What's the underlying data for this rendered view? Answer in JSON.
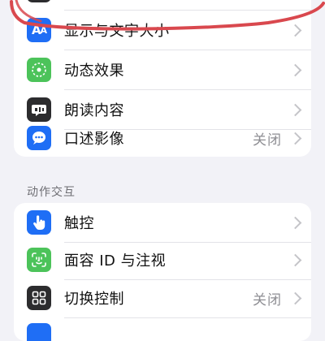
{
  "top_group": {
    "items": [
      {
        "label": "",
        "icon": "partial-hidden-icon",
        "icon_color": "#2c2c2e"
      },
      {
        "label": "显示与文字大小",
        "icon": "text-size-icon",
        "icon_color": "#1f6ef5",
        "value": ""
      },
      {
        "label": "动态效果",
        "icon": "motion-icon",
        "icon_color": "#4cc35a",
        "value": ""
      },
      {
        "label": "朗读内容",
        "icon": "speech-bubble-icon",
        "icon_color": "#2c2c2e",
        "value": ""
      },
      {
        "label": "口述影像",
        "icon": "audio-description-icon",
        "icon_color": "#1f6ef5",
        "value": "关闭"
      }
    ]
  },
  "section_header": "动作交互",
  "bottom_group": {
    "items": [
      {
        "label": "触控",
        "icon": "touch-hand-icon",
        "icon_color": "#1f6ef5",
        "value": ""
      },
      {
        "label": "面容 ID 与注视",
        "icon": "face-id-icon",
        "icon_color": "#4cc35a",
        "value": ""
      },
      {
        "label": "切换控制",
        "icon": "switch-control-icon",
        "icon_color": "#2c2c2e",
        "value": "关闭"
      },
      {
        "label": "",
        "icon": "partial-hidden-icon",
        "icon_color": "#1f6ef5",
        "value": ""
      }
    ]
  },
  "annotation_color": "#d9484e"
}
